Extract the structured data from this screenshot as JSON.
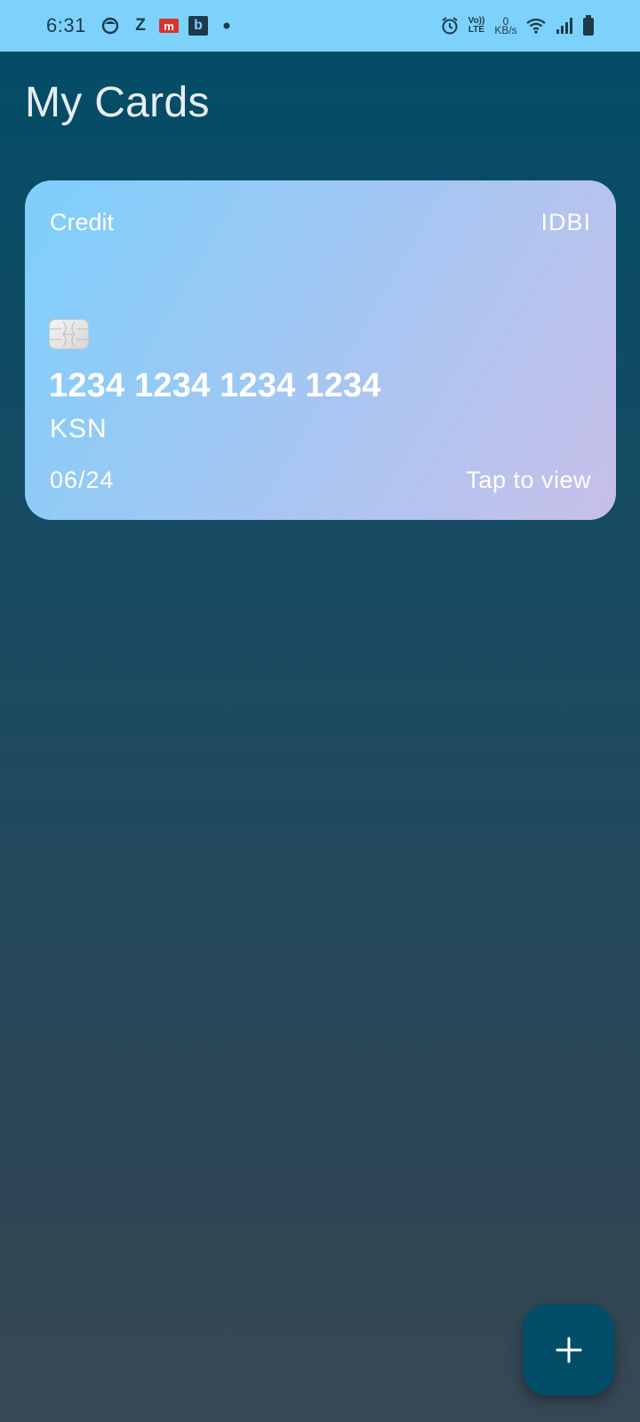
{
  "status_bar": {
    "time": "6:31",
    "notification_letters": {
      "z": "Z",
      "m": "m",
      "b": "b"
    },
    "volte_label_top": "Vo))",
    "volte_label_bottom": "LTE",
    "net_speed_value": "0",
    "net_speed_unit": "KB/s",
    "background_color": "#7dd2fc"
  },
  "header": {
    "title": "My Cards"
  },
  "cards": [
    {
      "type": "Credit",
      "bank": "IDBI",
      "number": "1234 1234 1234 1234",
      "holder": "KSN",
      "expiry": "06/24",
      "action_label": "Tap to view",
      "gradient_start": "#7dcffc",
      "gradient_end": "#c7bfe8"
    }
  ],
  "fab": {
    "icon": "plus-icon",
    "color": "#024d68"
  },
  "icons": {
    "status": [
      "face-app-icon",
      "z-app-icon",
      "m-app-icon",
      "b-app-icon",
      "dot-icon",
      "alarm-icon",
      "volte-icon",
      "net-speed",
      "wifi-icon",
      "signal-icon",
      "battery-icon"
    ]
  }
}
